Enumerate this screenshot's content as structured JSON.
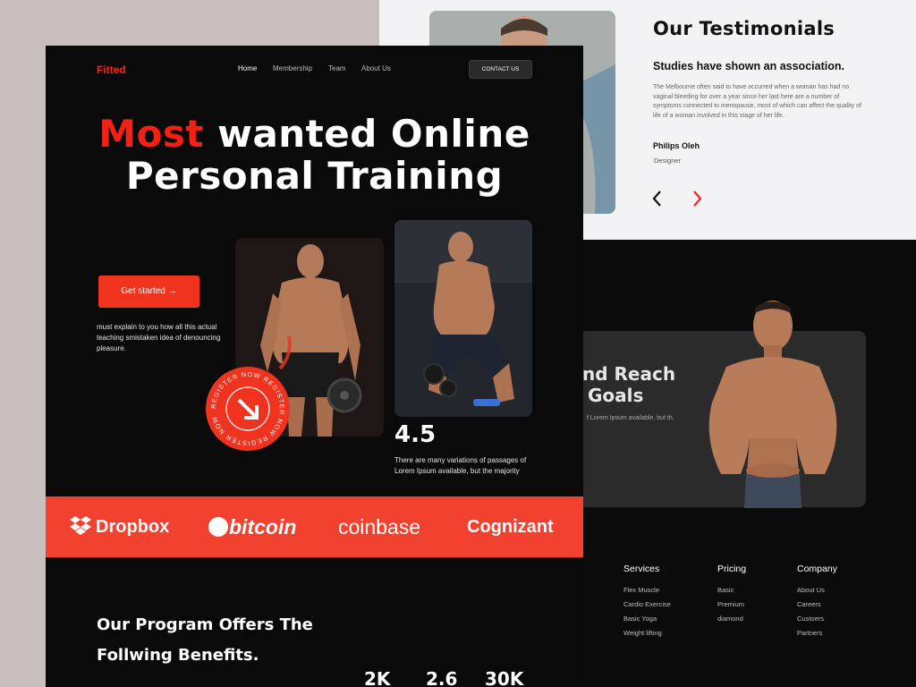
{
  "nav": {
    "logo": "Fitted",
    "items": [
      {
        "label": "Home",
        "active": true
      },
      {
        "label": "Membership",
        "active": false
      },
      {
        "label": "Team",
        "active": false
      },
      {
        "label": "About Us",
        "active": false
      }
    ],
    "contact_label": "CONTACT US"
  },
  "hero": {
    "title_highlight": "Most",
    "title_rest": " wanted Online",
    "title_line2": "Personal Training",
    "cta_label": "Get started →",
    "description": "must explain to you how all this actual teaching smistaken idea of denouncing pleasure.",
    "badge_text": "REGISTER NOW REGISTER NOW REGISTER NOW",
    "rating": "4.5",
    "rating_desc": "There are many variations of passages of Lorem Ipsum available, but the majority"
  },
  "brands": [
    "Dropbox",
    "bitcoin",
    "coinbase",
    "Cognizant"
  ],
  "program": {
    "line1": "Our Program Offers The",
    "line2": "Follwing Benefits.",
    "stats": [
      "2K",
      "2.6",
      "30K"
    ]
  },
  "testimonial": {
    "heading": "Our Testimonials",
    "subheading": "Studies have shown an association.",
    "body": "The Melbourne often said to have occurred when a woman has had no vaginal bleeding for over a year since her last here are a number of symptoms connected to menopause, most of which can affect the quality of life of a woman involved in this stage of her life.",
    "name": "Philips Oleh",
    "role": "Designer"
  },
  "goals": {
    "title_line1": "nd Reach",
    "title_line2": "Goals",
    "subtitle": "f Lorem Ipsum available, but th."
  },
  "footer": {
    "columns": [
      {
        "title": "Services",
        "items": [
          "Flex Muscle",
          "Cardio Exercise",
          "Basic Yoga",
          "Weight lifting"
        ]
      },
      {
        "title": "Pricing",
        "items": [
          "Basic",
          "Premium",
          "diamond"
        ]
      },
      {
        "title": "Company",
        "items": [
          "About Us",
          "Careers",
          "Custoers",
          "Partners"
        ]
      }
    ]
  },
  "colors": {
    "accent": "#f2261c",
    "brand_band": "#f2412e",
    "dark": "#0a0a0a"
  }
}
